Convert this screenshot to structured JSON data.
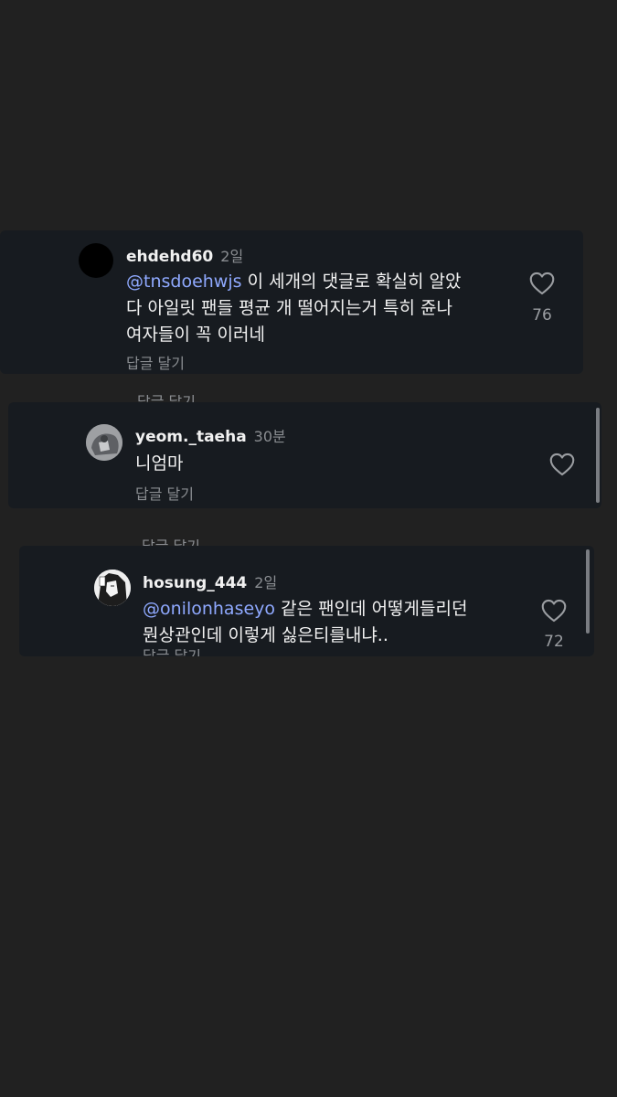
{
  "comments": [
    {
      "username": "ehdehd60",
      "time": "2일",
      "mention": "@tnsdoehwjs",
      "text_line1": " 이 세개의 댓글로 확실히 알았",
      "text_line2": "다 아일릿 팬들 평균 개 떨어지는거 특히 쥰나",
      "text_line3": "여자들이 꼭 이러네",
      "reply_label": "답글 달기",
      "likes": "76",
      "avatar_icon": "black-avatar"
    },
    {
      "username": "yeom._taeha",
      "time": "30분",
      "text": "니엄마",
      "reply_label": "답글 달기",
      "avatar_icon": "gray-avatar"
    },
    {
      "username": "hosung_444",
      "time": "2일",
      "mention": "@onilonhaseyo",
      "text_line1": " 같은 팬인데 어떻게들리던",
      "text_line2": "뭔상관인데 이렇게 싫은티를내냐..",
      "reply_label": "답글 달기",
      "likes": "72",
      "avatar_icon": "manga-avatar"
    }
  ],
  "colors": {
    "background": "#212121",
    "card": "#171b20",
    "mention": "#8fa9ff",
    "muted": "#8a8d91"
  }
}
